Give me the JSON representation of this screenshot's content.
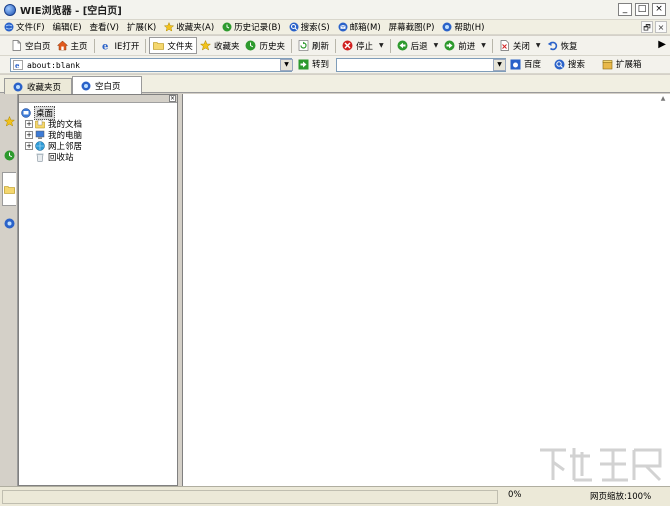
{
  "window": {
    "title": "WIE浏览器 - [空白页]",
    "min": "_",
    "max": "□",
    "close": "×"
  },
  "menu": {
    "items": [
      {
        "label": "文件(F)",
        "icon": "globe-icon"
      },
      {
        "label": "编辑(E)",
        "icon": ""
      },
      {
        "label": "查看(V)",
        "icon": ""
      },
      {
        "label": "扩展(K)",
        "icon": ""
      },
      {
        "label": "收藏夹(A)",
        "icon": "star-icon"
      },
      {
        "label": "历史记录(B)",
        "icon": "history-icon"
      },
      {
        "label": "搜索(S)",
        "icon": "search-icon"
      },
      {
        "label": "邮箱(M)",
        "icon": "mail-icon"
      },
      {
        "label": "屏幕截图(P)",
        "icon": ""
      },
      {
        "label": "帮助(H)",
        "icon": "help-icon"
      }
    ],
    "restore": "🗗",
    "close": "×"
  },
  "toolbar": {
    "blank_page": "空白页",
    "home": "主页",
    "ie_open": "IE打开",
    "folders": "文件夹",
    "favorites": "收藏夹",
    "history": "历史夹",
    "refresh": "刷新",
    "stop": "停止",
    "back": "后退",
    "forward": "前进",
    "close": "关闭",
    "restore": "恢复"
  },
  "address": {
    "url": "about:blank",
    "go_label": "转到",
    "search_value": "",
    "baidu_label": "百度",
    "search_label": "搜索",
    "extensions_label": "扩展箱"
  },
  "tabs": [
    {
      "label": "收藏夹页"
    },
    {
      "label": "空白页"
    }
  ],
  "tree": {
    "root": "桌面",
    "items": [
      {
        "label": "我的文档",
        "expander": "+"
      },
      {
        "label": "我的电脑",
        "expander": "+"
      },
      {
        "label": "网上邻居",
        "expander": "+"
      },
      {
        "label": "回收站",
        "expander": ""
      }
    ]
  },
  "status": {
    "text": "",
    "progress": "0%",
    "zoom": "网页缩放:100%"
  },
  "colors": {
    "accent_blue": "#1a4fb0",
    "star_yellow": "#f2c21b",
    "green": "#2e9a2e",
    "red": "#d02020"
  }
}
